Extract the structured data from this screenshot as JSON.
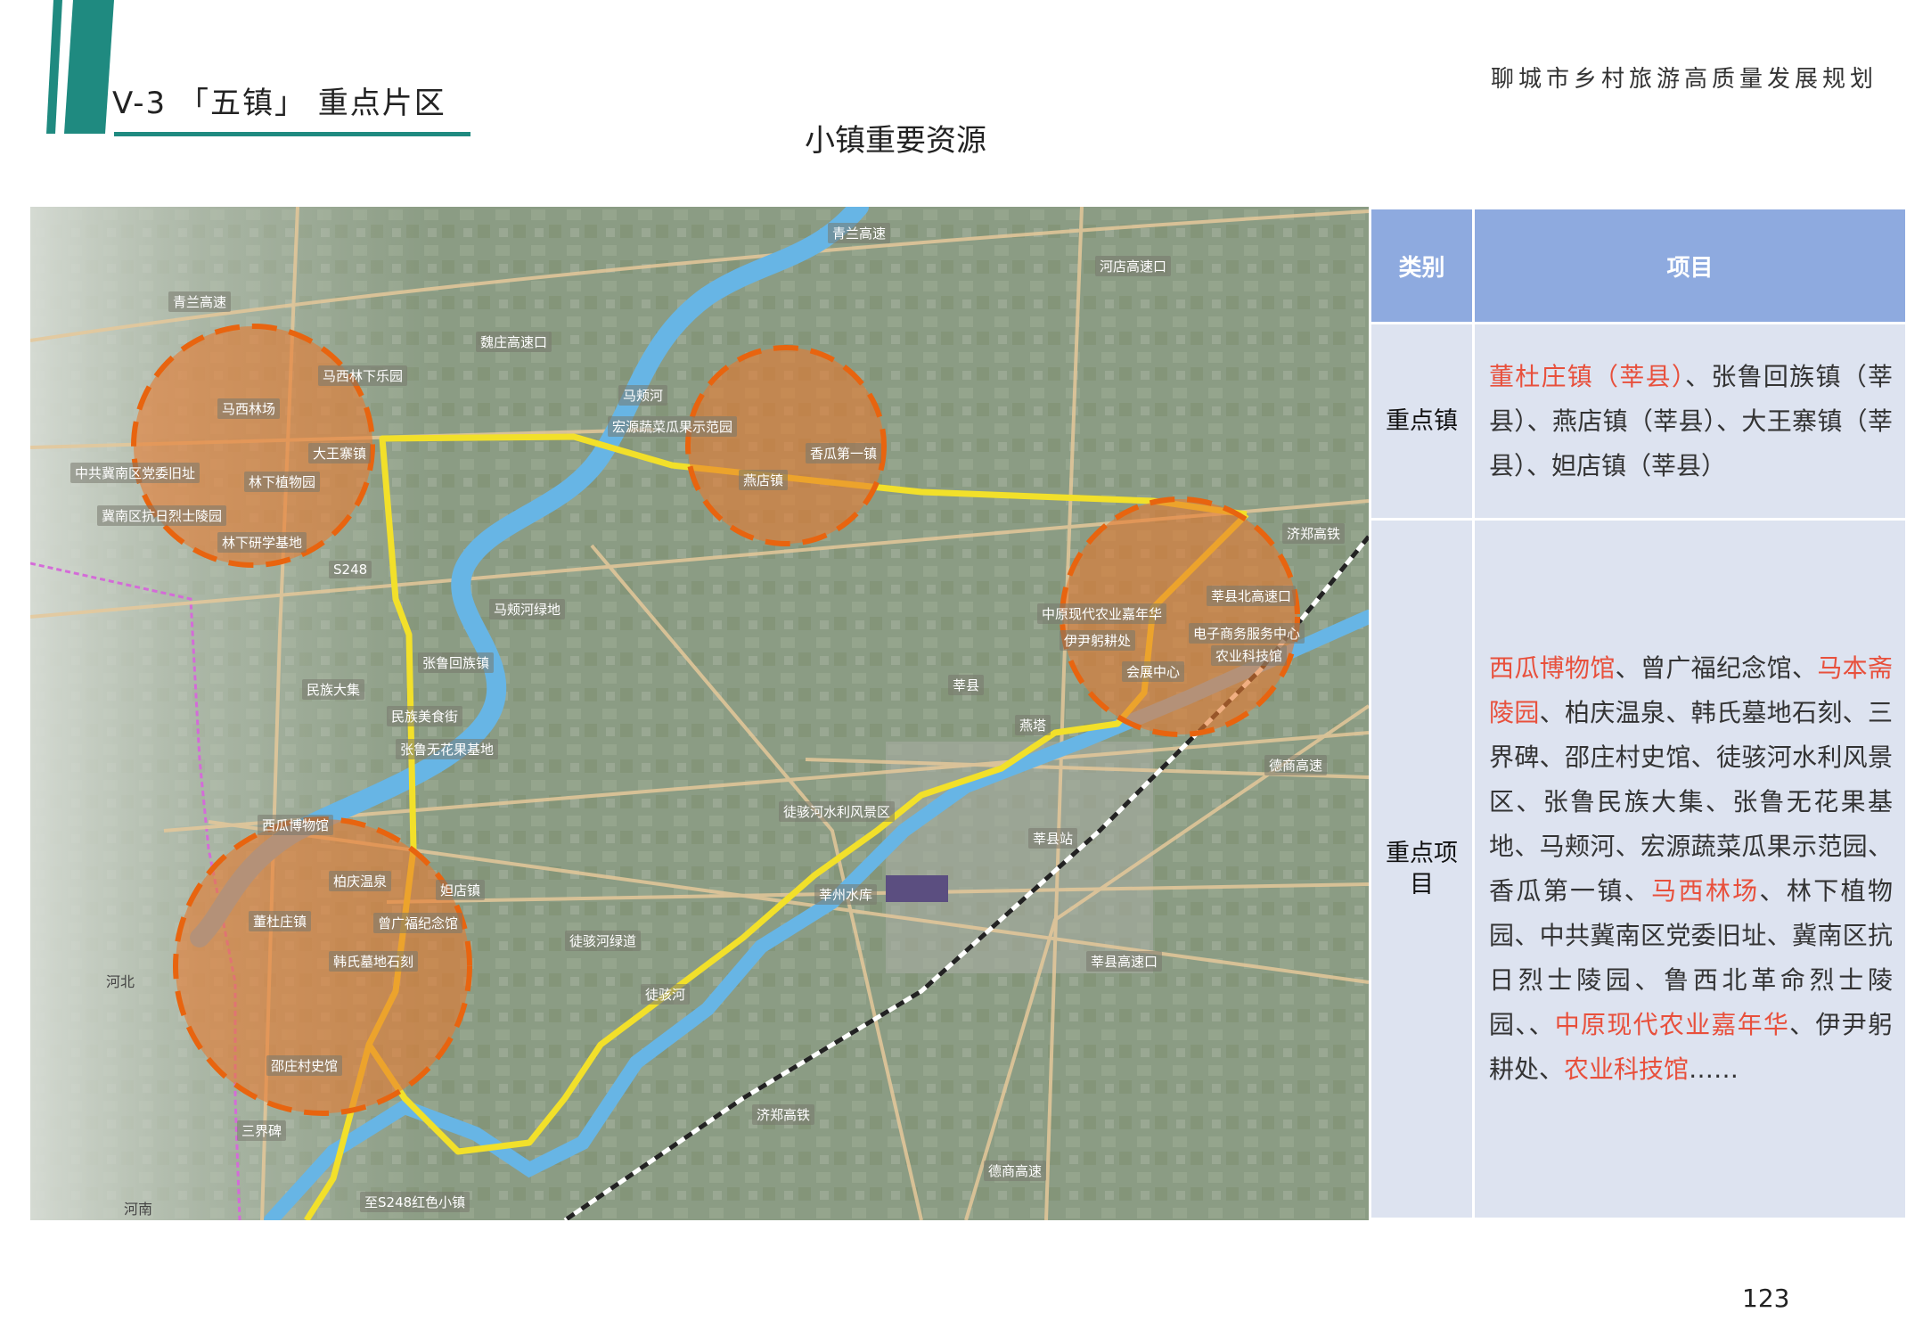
{
  "header": {
    "section_title": "V-3 「五镇」 重点片区",
    "document_title": "聊城市乡村旅游高质量发展规划",
    "page_heading": "小镇重要资源"
  },
  "map": {
    "labels": {
      "qinglan_exp_1": "青兰高速",
      "qinglan_exp_2": "青兰高速",
      "hedian_exit": "河店高速口",
      "weizhuang_exit": "魏庄高速口",
      "majia_forest": "马西林下乐园",
      "maxi_forest": "马西林场",
      "dawang": "大王寨镇",
      "cpc_office": "中共冀南区党委旧址",
      "forest_garden": "林下植物园",
      "jinan_martyrs": "冀南区抗日烈士陵园",
      "forest_base": "林下研学基地",
      "s248": "S248",
      "majia_river": "马颊河",
      "hongyuan": "宏源蔬菜瓜果示范园",
      "xianggua": "香瓜第一镇",
      "yandian": "燕店镇",
      "majia_wetland": "马颊河绿地",
      "zhanglu_town": "张鲁回族镇",
      "ethnic_market": "民族大集",
      "ethnic_food": "民族美食街",
      "fig_base": "张鲁无花果基地",
      "jizheng_rail": "济郑高铁",
      "agri_carnival": "中原现代农业嘉年华",
      "yiyin": "伊尹躬耕处",
      "ecommerce": "电子商务服务中心",
      "agri_museum": "农业科技馆",
      "shen_exit": "莘县北高速口",
      "convention": "会展中心",
      "shenxian": "莘县",
      "yanta": "燕塔",
      "tuhai_scenic": "徒骇河水利风景区",
      "shen_station": "莘县站",
      "shenzhou_reservoir": "莘州水库",
      "dezhou_exp": "德商高速",
      "shen_exp_exit": "莘县高速口",
      "xigua": "西瓜博物馆",
      "baiqing": "柏庆温泉",
      "zuodian": "妲店镇",
      "dongdu": "董杜庄镇",
      "zengguangfu": "曾广福纪念馆",
      "hanshi": "韩氏墓地石刻",
      "tuhai_green": "徒骇河绿道",
      "tuhai_river": "徒骇河",
      "shaozhuang": "邵庄村史馆",
      "sanjie": "三界碑",
      "jizheng_rail_2": "济郑高铁",
      "dezhou_exp_2": "德商高速",
      "to_s248": "至S248红色小镇",
      "hebei": "河北",
      "henan": "河南"
    }
  },
  "table": {
    "header": {
      "category": "类别",
      "items": "项目"
    },
    "rows": [
      {
        "category": "重点镇",
        "segments": [
          {
            "text": "董杜庄镇（莘县）",
            "highlight": true
          },
          {
            "text": "、张鲁回族镇（莘县）、燕店镇（莘县）、大王寨镇（莘县）、妲店镇（莘县）",
            "highlight": false
          }
        ]
      },
      {
        "category": "重点项目",
        "segments": [
          {
            "text": "西瓜博物馆",
            "highlight": true
          },
          {
            "text": "、曾广福纪念馆、",
            "highlight": false
          },
          {
            "text": "马本斋陵园",
            "highlight": true
          },
          {
            "text": "、柏庆温泉、韩氏墓地石刻、三界碑、邵庄村史馆、徒骇河水利风景区、张鲁民族大集、张鲁无花果基地、马颊河、宏源蔬菜瓜果示范园、香瓜第一镇、",
            "highlight": false
          },
          {
            "text": "马西林场",
            "highlight": true
          },
          {
            "text": "、林下植物园、中共冀南区党委旧址、冀南区抗日烈士陵园、鲁西北革命烈士陵园、、",
            "highlight": false
          },
          {
            "text": "中原现代农业嘉年华",
            "highlight": true
          },
          {
            "text": "、伊尹躬耕处、",
            "highlight": false
          },
          {
            "text": "农业科技馆",
            "highlight": true
          },
          {
            "text": "……",
            "highlight": false
          }
        ]
      }
    ]
  },
  "colors": {
    "accent_teal": "#1f8a80",
    "highlight_red": "#e8503c",
    "table_header_blue": "#8eaadf",
    "table_cell": "#dde3f0",
    "route_yellow": "#f2e02a",
    "circle_orange": "#e8792f"
  },
  "footer": {
    "page_number": "123"
  }
}
